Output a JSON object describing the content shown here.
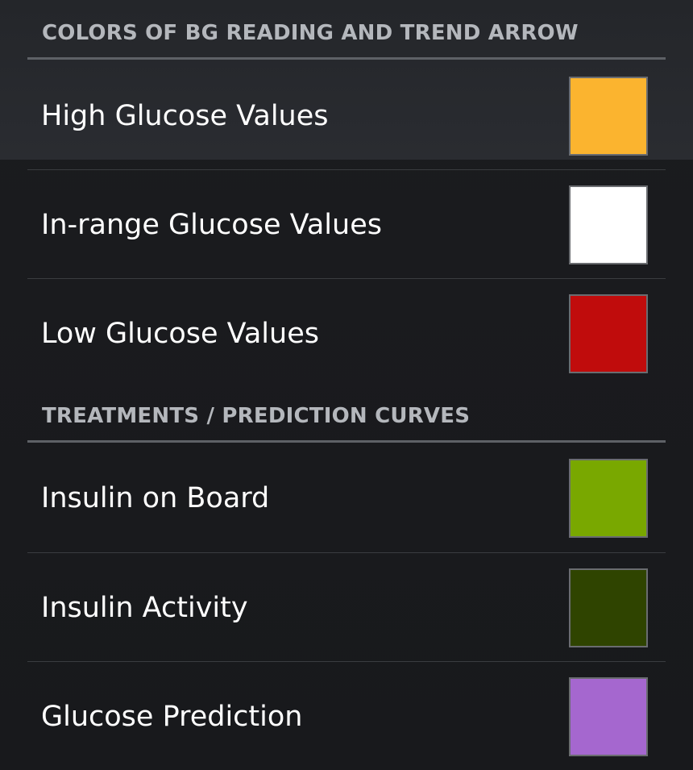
{
  "sections": [
    {
      "title": "COLORS OF BG READING AND TREND ARROW",
      "items": [
        {
          "label": "High Glucose Values",
          "color": "#fbb42f"
        },
        {
          "label": "In-range Glucose Values",
          "color": "#ffffff"
        },
        {
          "label": "Low Glucose Values",
          "color": "#c00c0c"
        }
      ]
    },
    {
      "title": "TREATMENTS / PREDICTION CURVES",
      "items": [
        {
          "label": "Insulin on Board",
          "color": "#79a800"
        },
        {
          "label": "Insulin Activity",
          "color": "#2f4400"
        },
        {
          "label": "Glucose Prediction",
          "color": "#a567cf"
        }
      ]
    }
  ]
}
